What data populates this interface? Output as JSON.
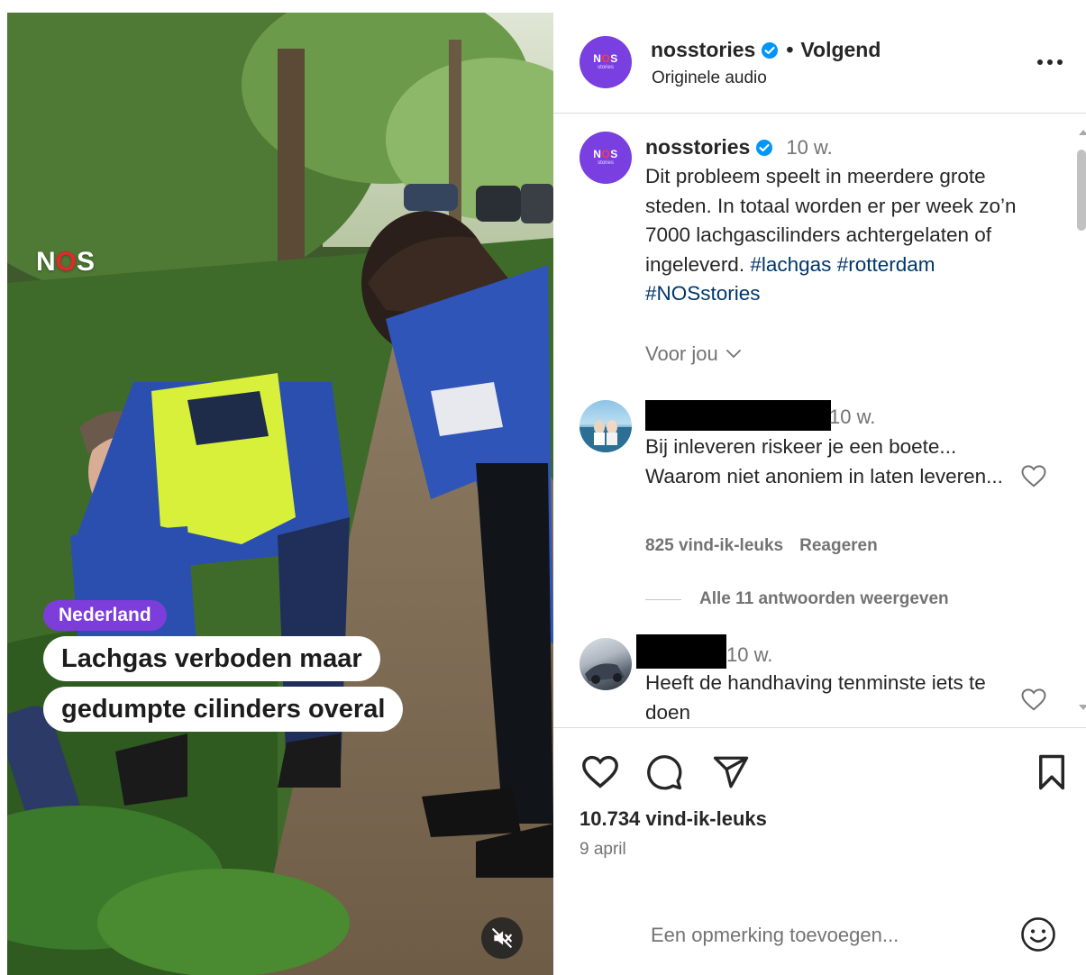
{
  "media": {
    "brand_logo_text": "NOS",
    "category_badge": "Nederland",
    "headline_line1": "Lachgas verboden maar",
    "headline_line2": "gedumpte cilinders overal",
    "mute_icon": "speaker-muted-icon"
  },
  "header": {
    "username": "nosstories",
    "verified": true,
    "separator": "•",
    "follow_label": "Volgend",
    "audio_label": "Originele audio",
    "avatar_text": "NOS",
    "avatar_subtext": "stories"
  },
  "caption": {
    "username": "nosstories",
    "time": "10 w.",
    "text_before": "Dit probleem speelt in meerdere grote steden. In totaal worden er per week zo’n 7000 lachgascilinders achtergelaten of ingeleverd.",
    "hashtag_1": "#lachgas",
    "hashtag_2": "#rotterdam",
    "hashtag_3": "#NOSstories",
    "voor_jou": "Voor jou"
  },
  "comments": [
    {
      "time": "10 w.",
      "text": "Bij inleveren riskeer je een boete... Waarom niet anoniem in laten leveren...",
      "likes": "825 vind-ik-leuks",
      "reply_label": "Reageren",
      "view_replies": "Alle 11 antwoorden weergeven"
    },
    {
      "time": "10 w.",
      "text": "Heeft de handhaving tenminste iets te doen"
    }
  ],
  "footer": {
    "likes_count": "10.734 vind-ik-leuks",
    "date": "9 april",
    "comment_placeholder": "Een opmerking toevoegen...",
    "icons": [
      "heart-icon",
      "comment-icon",
      "share-icon",
      "bookmark-icon",
      "emoji-icon"
    ]
  },
  "colors": {
    "brand_purple": "#7a3fe0",
    "badge_purple": "#7c3ddb",
    "verified_blue": "#0095f6",
    "hashtag_blue": "#00376b",
    "nos_red": "#e6262b"
  }
}
